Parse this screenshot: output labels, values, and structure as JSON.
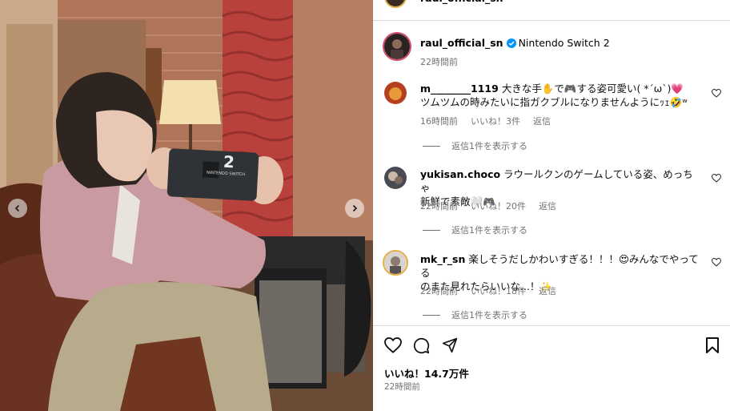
{
  "post": {
    "username": "raul_official_sn",
    "location": "Nintendo Switch 2",
    "time": "22時間前",
    "top_partial_username": "raul_official_sn"
  },
  "comments": [
    {
      "username": "m________1119",
      "text_line1": "大きな手✋で🎮する姿可愛い( *ˊωˋ)💗",
      "text_line2": "ツムツムの時みたいに指ガクブルになりませんようにｯｪ🤣ʷ",
      "time": "16時間前",
      "likes": "いいね！3件",
      "reply": "返信",
      "view_replies": "返信1件を表示する"
    },
    {
      "username": "yukisan.choco",
      "text_line1": "ラウールクンのゲームしている姿、めっちゃ",
      "text_line2": "新鮮で素敵🤍🎮",
      "time": "22時間前",
      "likes": "いいね！20件",
      "reply": "返信",
      "view_replies": "返信1件を表示する"
    },
    {
      "username": "mk_r_sn",
      "text_line1": "楽しそうだしかわいすぎる！！！😍みんなでやってる",
      "text_line2": "のまた見れたらいいな...！✨",
      "time": "22時間前",
      "likes": "いいね！18件",
      "reply": "返信",
      "view_replies": "返信1件を表示する"
    }
  ],
  "footer": {
    "likes": "いいね！14.7万件",
    "time": "22時間前"
  },
  "photo": {
    "console_logo": "2",
    "console_text": "NINTENDO SWITCH"
  },
  "icons": {
    "like": "heart-icon",
    "comment": "comment-icon",
    "share": "send-icon",
    "save": "bookmark-icon",
    "prev": "chevron-left-icon",
    "next": "chevron-right-icon",
    "verified": "verified-badge-icon"
  },
  "colors": {
    "verified": "#0095f6",
    "muted": "#737373"
  }
}
